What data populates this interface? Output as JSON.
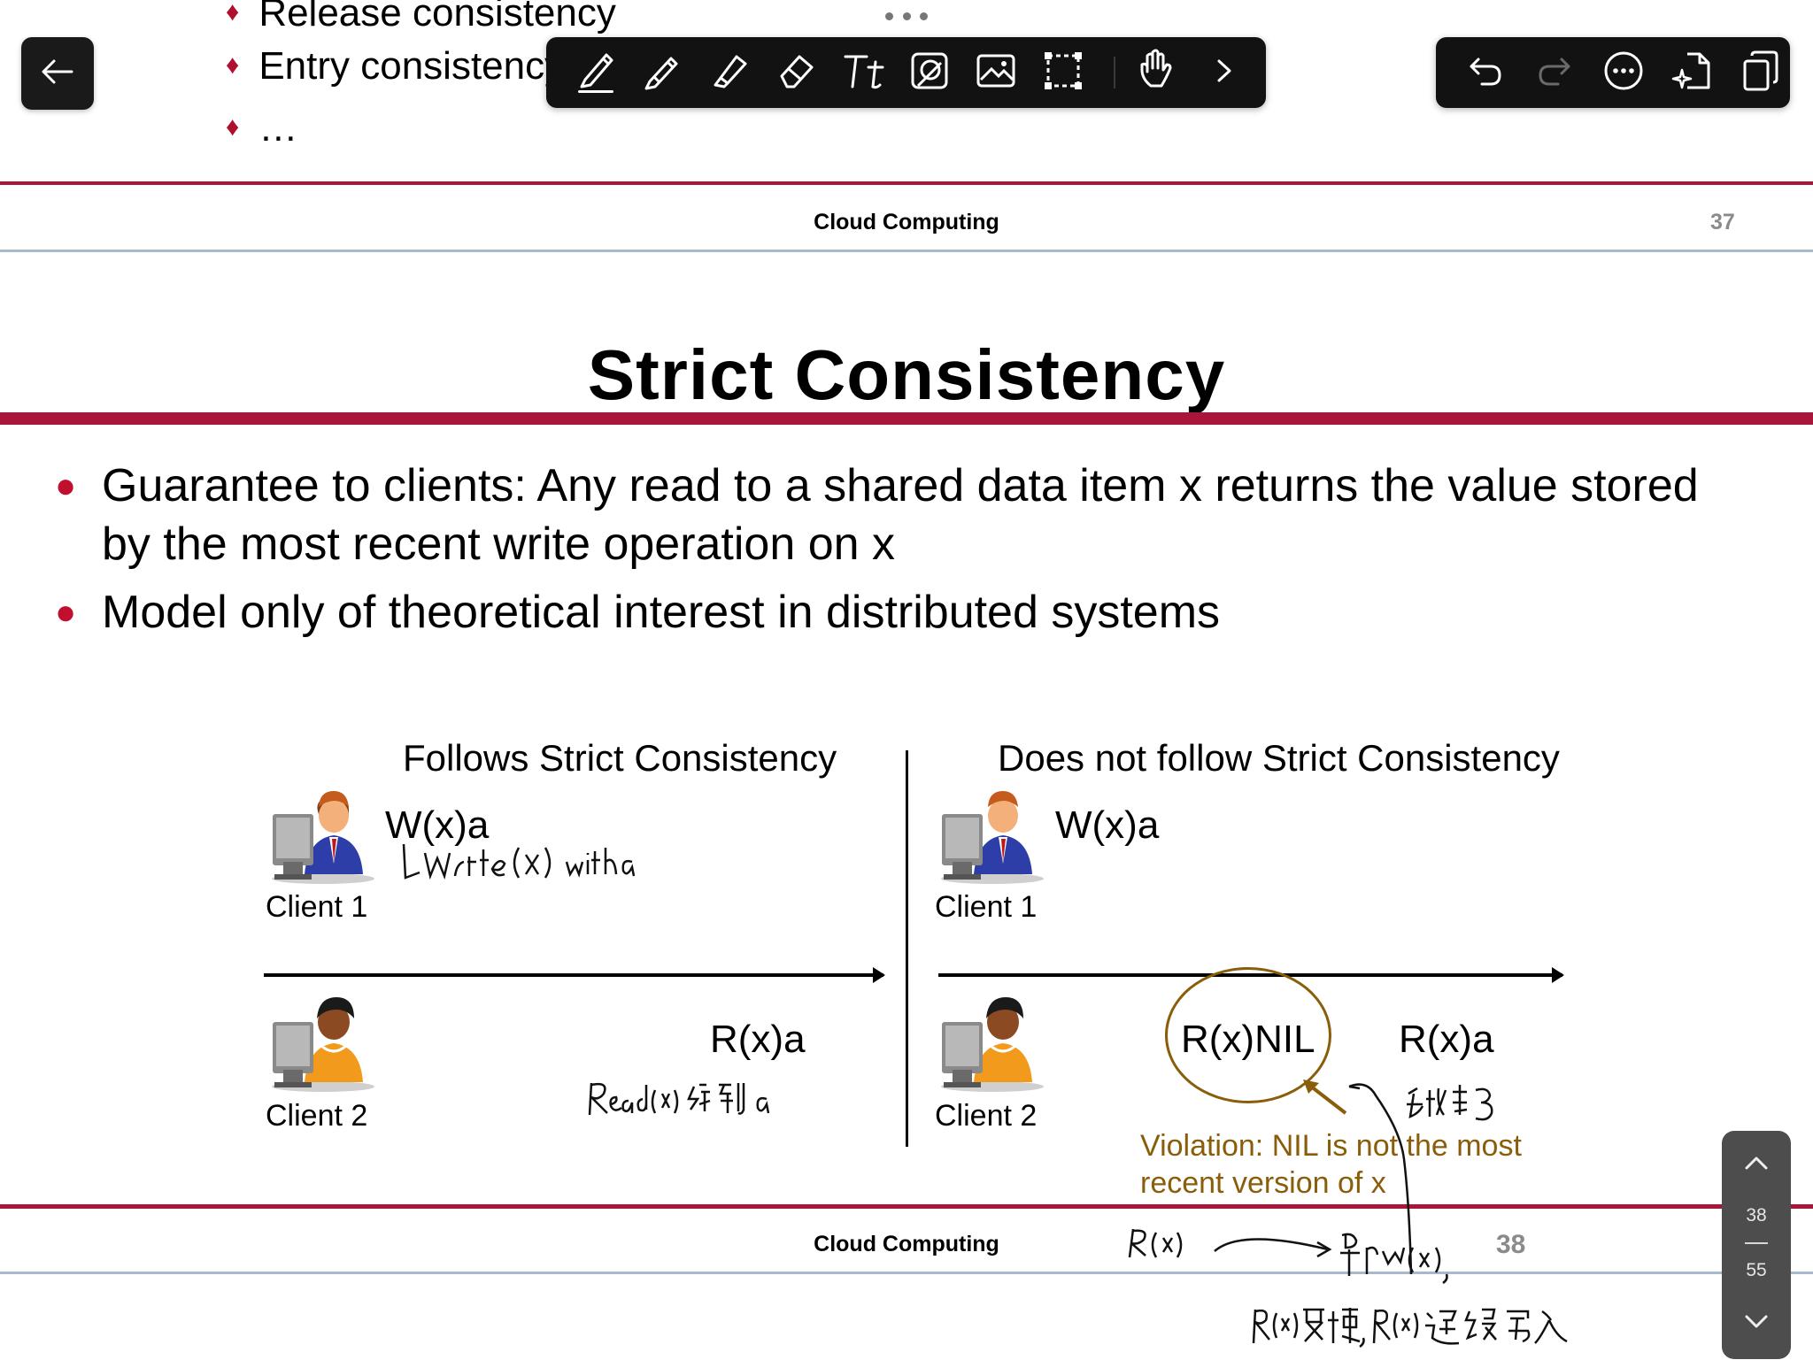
{
  "previous_slide": {
    "bullets": [
      "Release consistency",
      "Entry consistency",
      "…"
    ],
    "footer_title": "Cloud Computing",
    "page_number": "37"
  },
  "slide": {
    "title": "Strict Consistency",
    "bullets": [
      "Guarantee to clients: Any read to a shared data item x returns the value stored by the most recent write operation on x",
      "Model only of theoretical interest in distributed systems"
    ],
    "diagram": {
      "left": {
        "heading": "Follows Strict Consistency",
        "client1_op": "W(x)a",
        "client1_label": "Client 1",
        "client2_op": "R(x)a",
        "client2_label": "Client 2"
      },
      "right": {
        "heading": "Does not follow Strict Consistency",
        "client1_op": "W(x)a",
        "client1_label": "Client 1",
        "client2_op_violation": "R(x)NIL",
        "client2_op": "R(x)a",
        "client2_label": "Client 2",
        "violation_line1": "Violation: NIL is not the most",
        "violation_line2": "recent version of x"
      }
    },
    "footer_title": "Cloud Computing",
    "page_number": "38"
  },
  "handwritten_notes": {
    "note_write": "↳ write(x) with a",
    "note_read": "Read(x) 给到 a",
    "note_right_top": "先读到了",
    "note_bottom_left": "R(x)",
    "note_bottom_mid": "早于 W(x),",
    "note_bottom_right": "W(x)更快, R(x)延迟写入"
  },
  "pager": {
    "current_page": "38",
    "total_pages": "55"
  },
  "toolbar": {
    "tools": [
      "pen-icon",
      "pencil-icon",
      "highlighter-icon",
      "eraser-icon",
      "text-tool-icon",
      "shape-tool-icon",
      "image-icon",
      "lasso-select-icon",
      "touch-hand-icon",
      "chevron-right-icon"
    ],
    "selected_tool": "pen-icon"
  },
  "right_toolbar": {
    "tools": [
      "undo-icon",
      "redo-icon",
      "more-options-icon",
      "ai-page-icon",
      "copy-pages-icon"
    ]
  },
  "colors": {
    "accent_red": "#a9163a",
    "bullet_red": "#c0102e",
    "violation_brown": "#8a5d0a",
    "toolbar_bg": "#121212"
  }
}
